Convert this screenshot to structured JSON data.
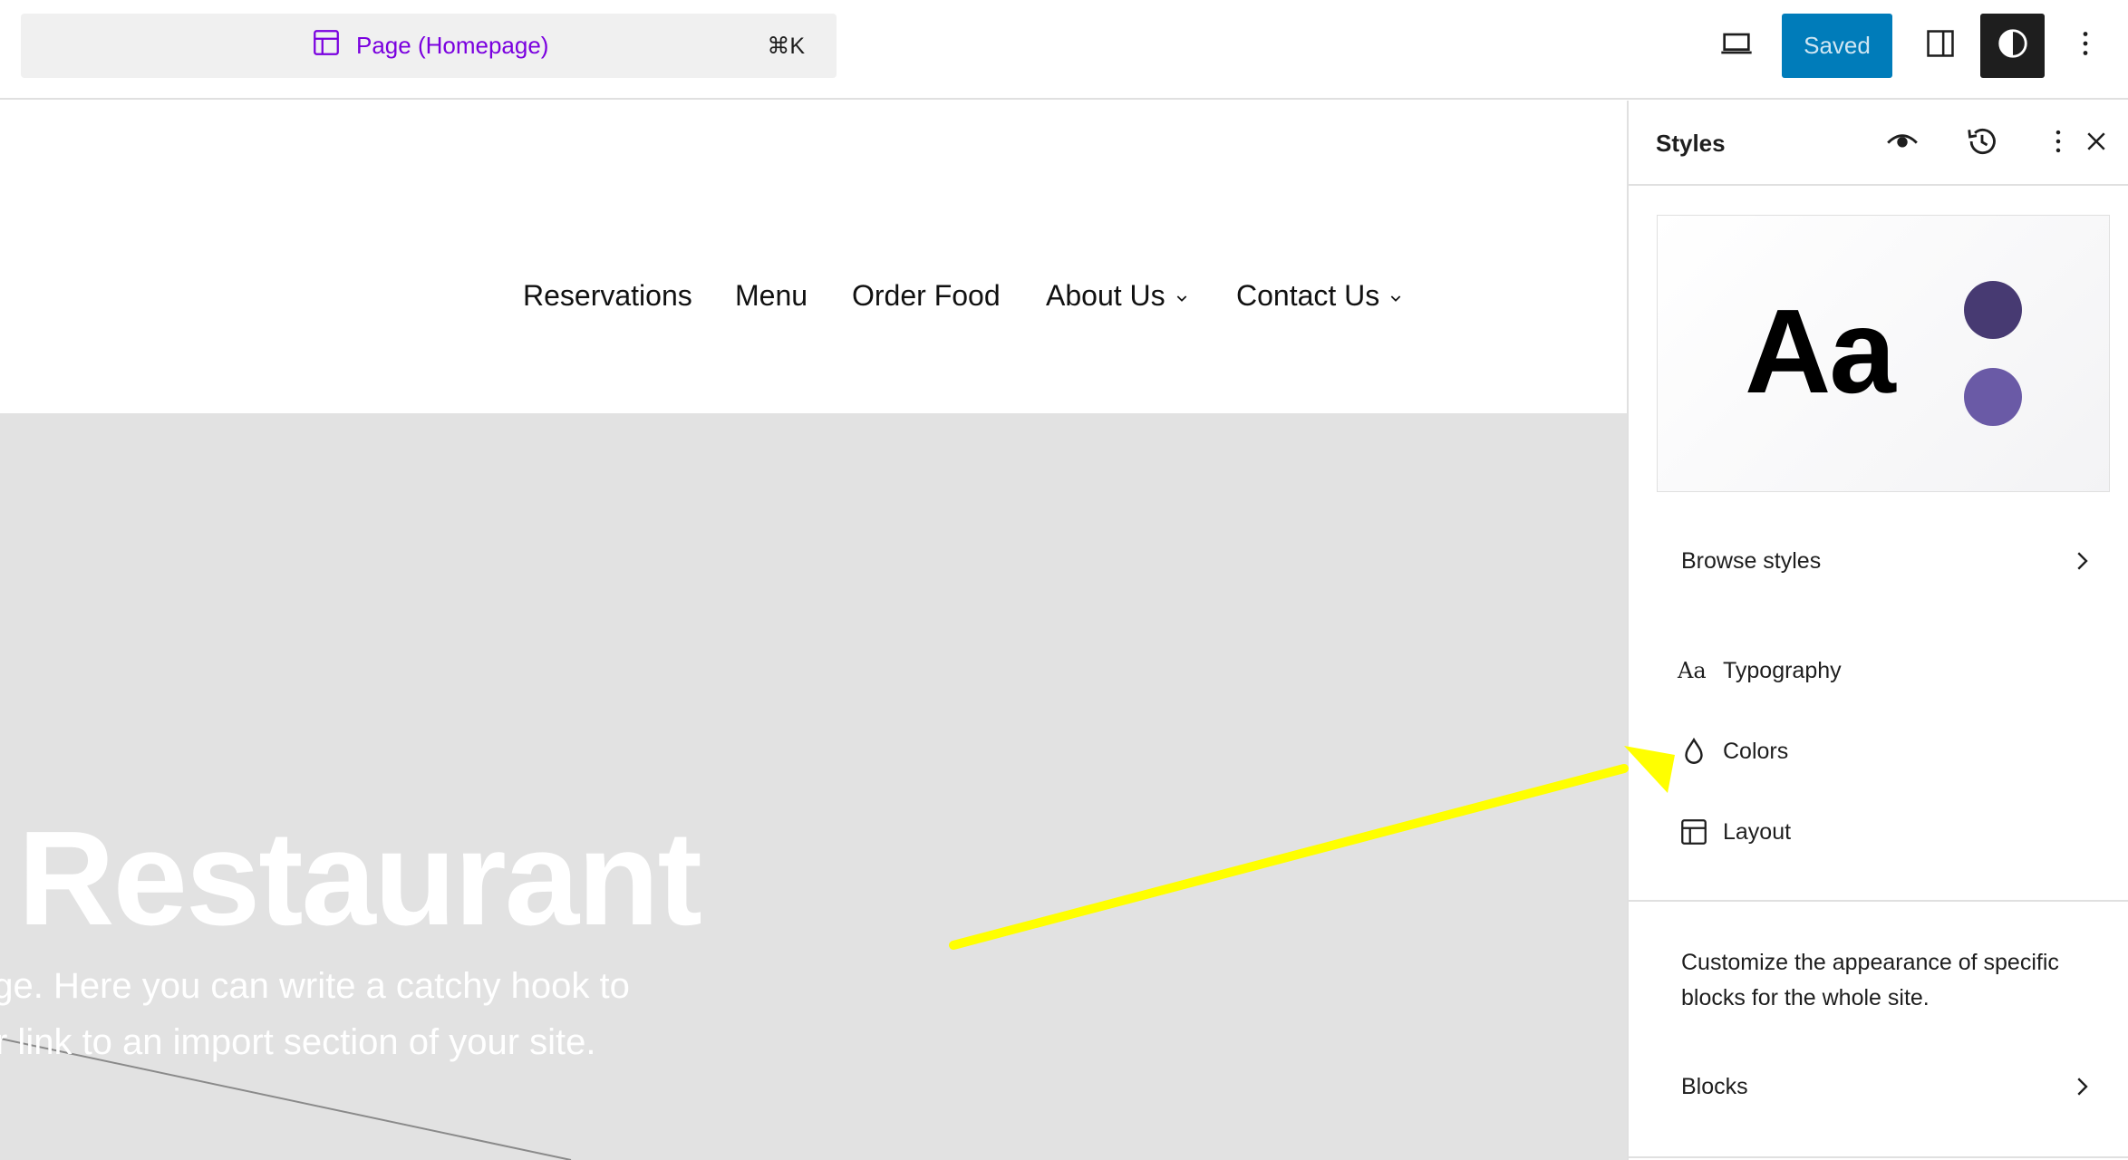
{
  "topbar": {
    "document_title": "Page (Homepage)",
    "shortcut": "⌘K",
    "save_label": "Saved",
    "icons": [
      "layout-icon",
      "desktop-icon",
      "sidebar-icon",
      "contrast-icon",
      "more-vertical-icon"
    ]
  },
  "canvas": {
    "navigation": [
      "Reservations",
      "Menu",
      "Order Food",
      "About Us",
      "Contact Us"
    ],
    "hero": {
      "title": "r Restaurant",
      "text_line_1": "age. Here you can write a catchy hook to",
      "text_line_2": "r link to an import section of your site."
    }
  },
  "sidebar": {
    "title": "Styles",
    "header_icons": [
      "eye-icon",
      "revisions-icon",
      "more-vertical-icon",
      "close-icon"
    ],
    "preview": {
      "sample_text": "Aa",
      "swatch_colors": [
        "#473a72",
        "#6a5aa6"
      ]
    },
    "browse_styles": "Browse styles",
    "items": [
      {
        "label": "Typography",
        "icon": "typography-icon"
      },
      {
        "label": "Colors",
        "icon": "droplet-icon"
      },
      {
        "label": "Layout",
        "icon": "layout-icon"
      }
    ],
    "blocks_description": "Customize the appearance of specific blocks for the whole site.",
    "blocks_label": "Blocks"
  },
  "colors": {
    "accent": "#7a00df",
    "save_button": "#007cba",
    "annotation_arrow": "#ffff00",
    "hero_background": "#e2e2e2"
  }
}
